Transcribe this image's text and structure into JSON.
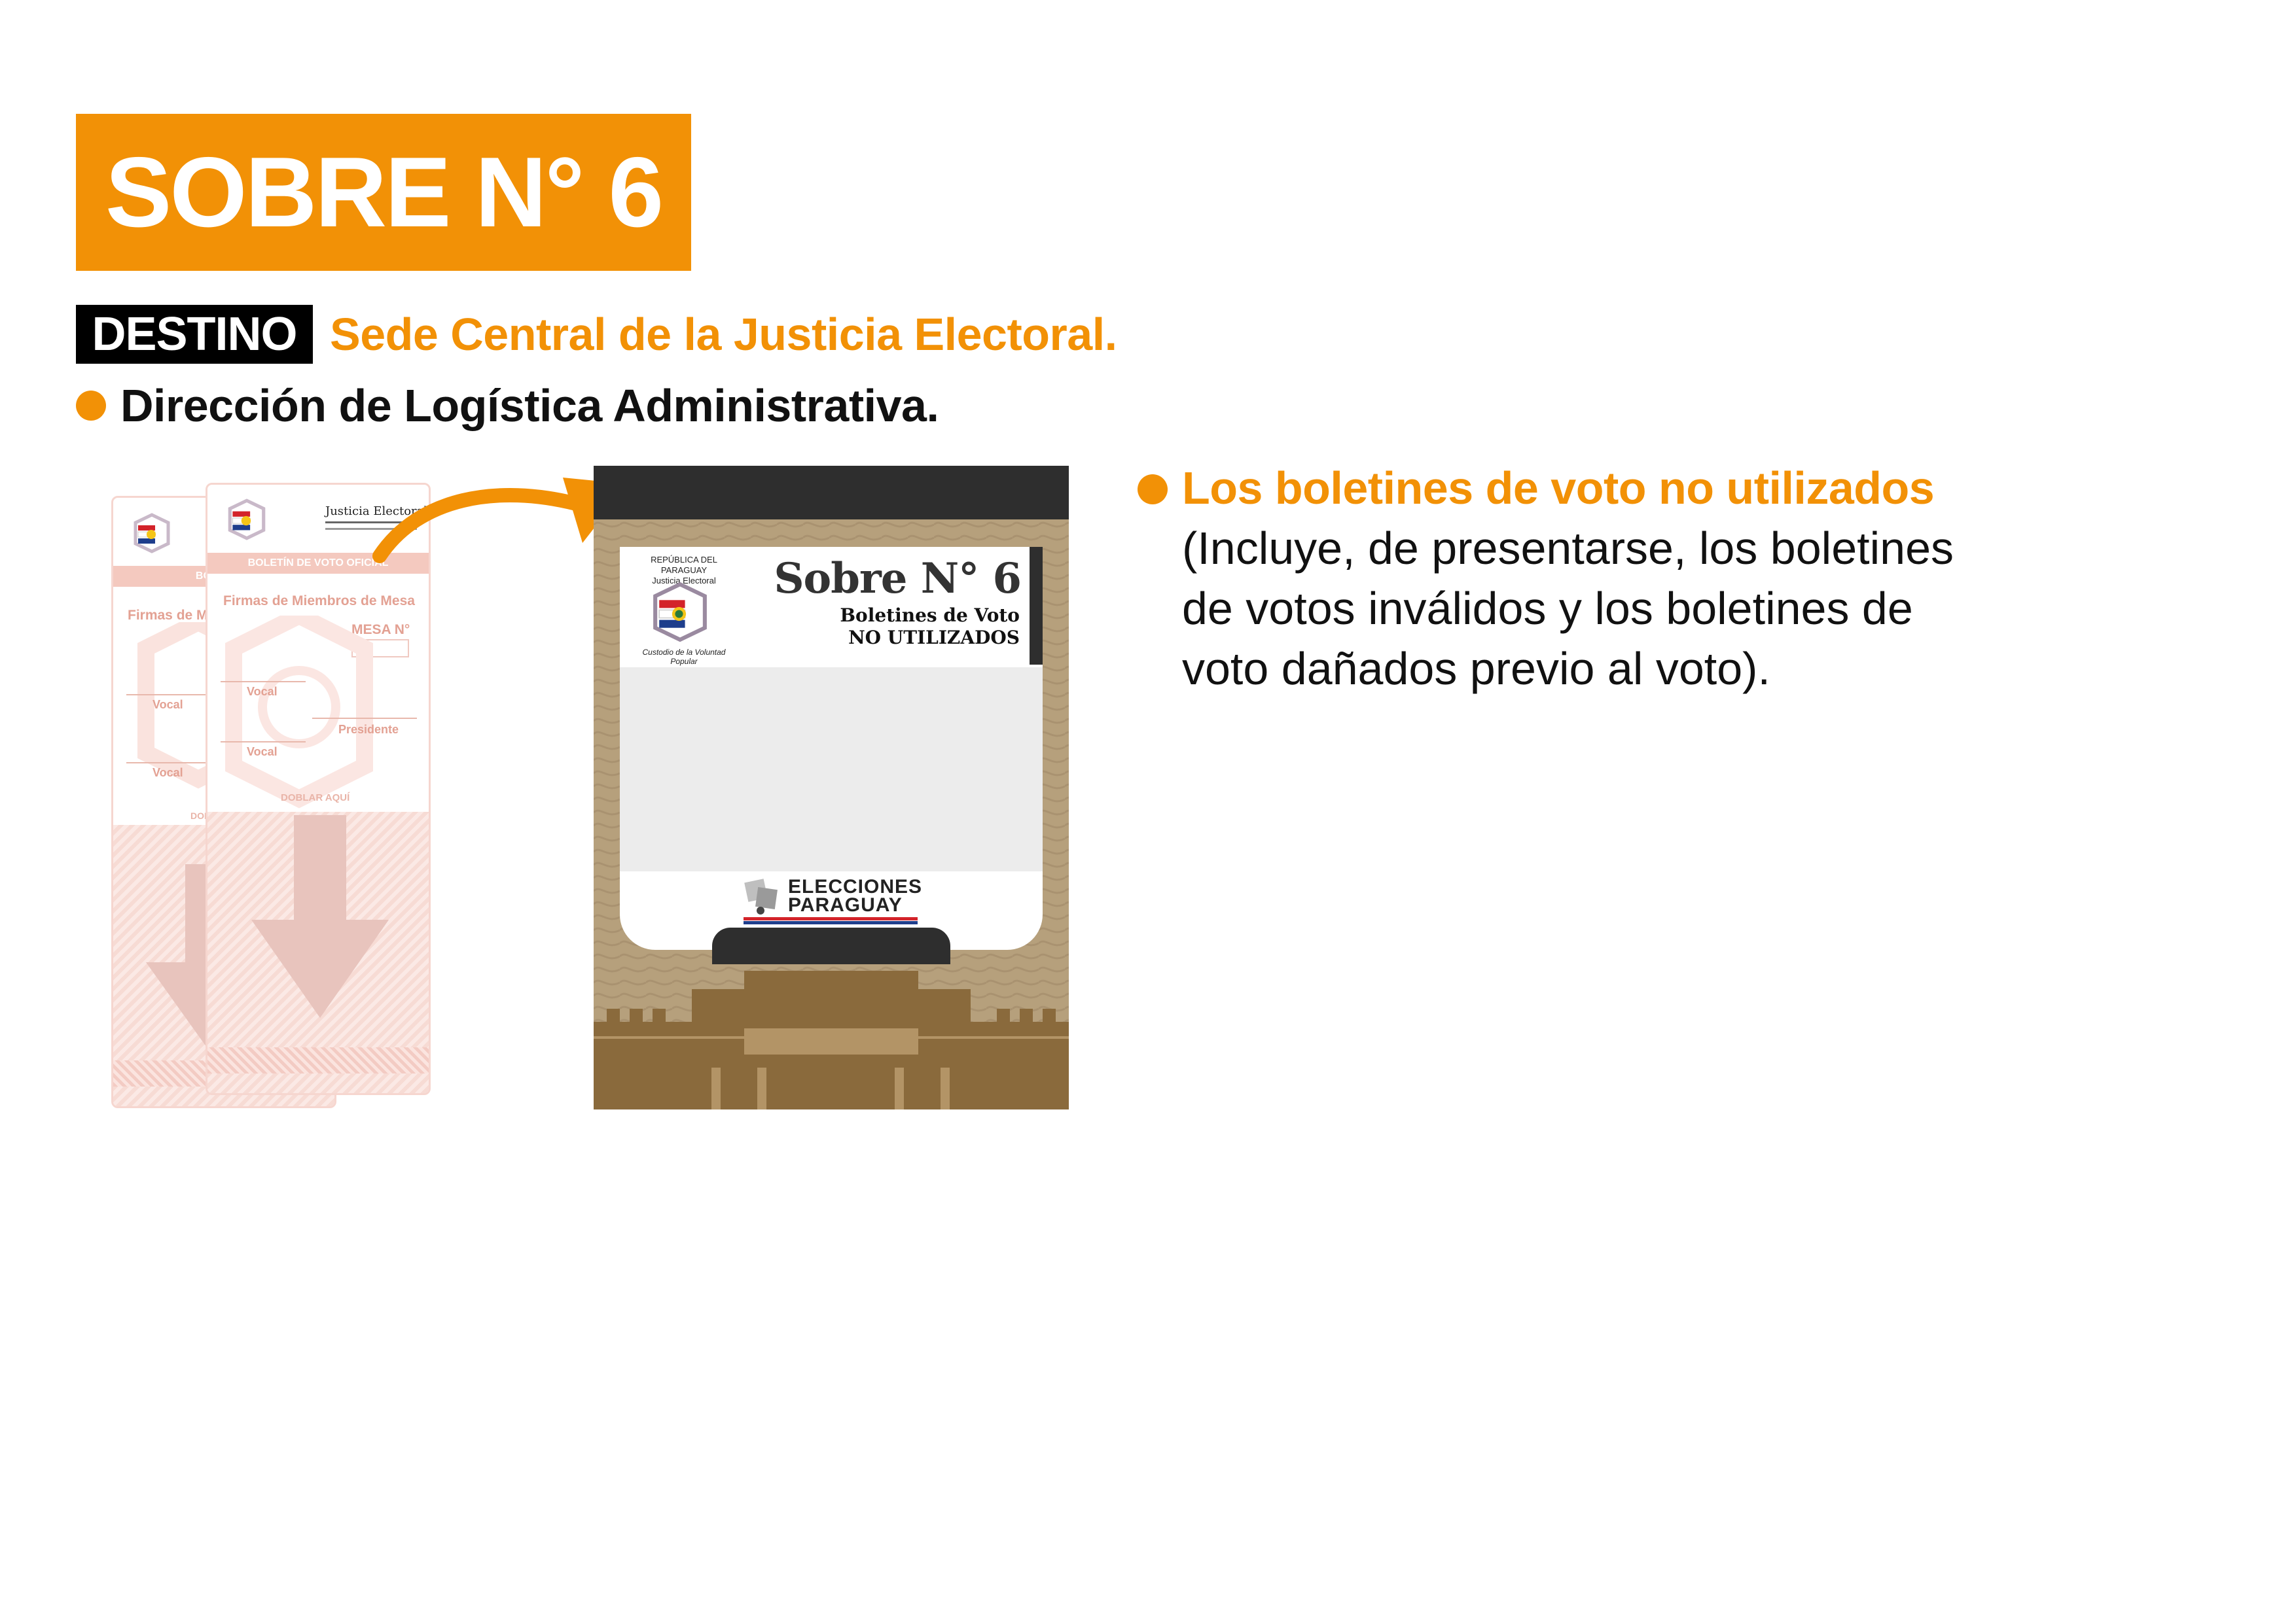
{
  "header": {
    "title": "SOBRE N° 6"
  },
  "destino": {
    "tag": "DESTINO",
    "text": "Sede Central de la Justicia Electoral.",
    "item": "Dirección de Logística Administrativa."
  },
  "description": {
    "title": "Los boletines de voto no utilizados",
    "body": "(Incluye, de presentarse, los boletines de votos inválidos y los boletines de voto dañados previo al voto)."
  },
  "ballot": {
    "org_name": "Justicia Electoral",
    "band_back": "BOLETÍN D",
    "band_front": "BOLETÍN DE VOTO OFICIAL",
    "firmas_back": "Firmas de M",
    "firmas_front": "Firmas de Miembros de Mesa",
    "mesa": "MESA N°",
    "vocal": "Vocal",
    "presidente": "Presidente",
    "doblar": "DOBLAR AQUÍ",
    "doblar_back": "DOB"
  },
  "envelope": {
    "title": "Sobre N° 6",
    "subtitle1": "Boletines de Voto",
    "subtitle2": "NO UTILIZADOS",
    "republica": "REPÚBLICA DEL PARAGUAY",
    "justicia": "Justicia Electoral",
    "custodio": "Custodio de la Voluntad Popular",
    "elecciones_1": "ELECCIONES",
    "elecciones_2": "PARAGUAY"
  },
  "colors": {
    "accent": "#f29106",
    "text": "#111111",
    "envelope": "#b6a07c",
    "envelope_dark": "#2e2e2e",
    "ballot_pink": "#f4c9bf"
  }
}
